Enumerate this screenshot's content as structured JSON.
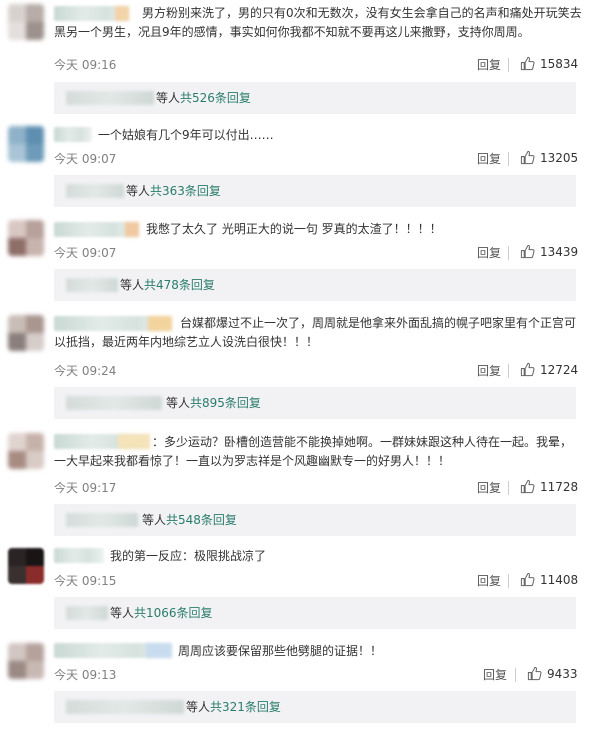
{
  "colors": {
    "link": "#2a7d6b",
    "thread_bg": "#f2f2f5",
    "time": "#808080"
  },
  "reply_label": "回复",
  "like_icon": "thumbs-up-icon",
  "comments": [
    {
      "text": "男方粉别来洗了，男的只有0次和无数次，没有女生会拿自己的名声和痛处开玩笑去黑另一个男生，况且9年的感情，事实如何你我都不知就不要再这儿来撒野，支持你周周。",
      "time": "今天 09:16",
      "likes": "15834",
      "thread_prefix": "等人",
      "thread_link": "共526条回复"
    },
    {
      "text": "一个姑娘有几个9年可以付出……",
      "time": "今天 09:07",
      "likes": "13205",
      "thread_prefix": "等人",
      "thread_link": "共363条回复"
    },
    {
      "text": "我憋了太久了 光明正大的说一句 罗真的太渣了！！！！",
      "time": "今天 09:07",
      "likes": "13439",
      "thread_prefix": "等人",
      "thread_link": "共478条回复"
    },
    {
      "text": "台媒都爆过不止一次了，周周就是他拿来外面乱搞的幌子吧家里有个正宫可以抵挡，最近两年内地综艺立人设洗白很快！！！",
      "time": "今天 09:24",
      "likes": "12724",
      "thread_prefix": "等人",
      "thread_link": "共895条回复"
    },
    {
      "text": "：多少运动？卧槽创造营能不能换掉她啊。一群妹妹跟这种人待在一起。我晕，一大早起来我都看惊了！一直以为罗志祥是个风趣幽默专一的好男人！！！",
      "time": "今天 09:17",
      "likes": "11728",
      "thread_prefix": "等人",
      "thread_link": "共548条回复"
    },
    {
      "text": "我的第一反应：极限挑战凉了",
      "time": "今天 09:15",
      "likes": "11408",
      "thread_prefix": "等人",
      "thread_link": "共1066条回复"
    },
    {
      "text": "周周应该要保留那些他劈腿的证据！！",
      "time": "今天 09:13",
      "likes": "9433",
      "thread_prefix": "等人",
      "thread_link": "共321条回复"
    }
  ]
}
